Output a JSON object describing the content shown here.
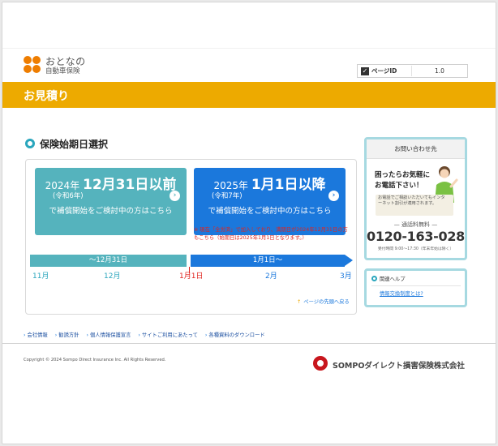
{
  "header": {
    "logo_line1": "おとなの",
    "logo_line2": "自動車保険",
    "page_id_label": "ページID",
    "page_id_value": "1.0"
  },
  "titlebar": {
    "title": "お見積り"
  },
  "section": {
    "title": "保険始期日選択"
  },
  "cards": [
    {
      "year_prefix": "2024年 ",
      "date": "12月31日",
      "suffix": "以前",
      "era": "(令和6年)",
      "cta": "で補償開始をご検討中の方はこちら"
    },
    {
      "year_prefix": "2025年 ",
      "date": "1月1日",
      "suffix": "以降",
      "era": "(令和7年)",
      "cta": "で補償開始をご検討中の方はこちら"
    }
  ],
  "note": "※ 現在「全労済」で加入しており、満期日が2024年12月31日の方もこちら（始期日は2025年1月1日となります。）",
  "timeline": {
    "left_label": "〜12月31日",
    "right_label": "1月1日〜",
    "months": [
      "11月",
      "12月",
      "1月1日",
      "2月",
      "3月"
    ]
  },
  "page_top_link": "ページの先頭へ戻る",
  "contact": {
    "title": "お問い合わせ先",
    "message": "困ったらお気軽にお電話下さい！",
    "bubble": "お電話でご相談いただいてもインターネット割引が適用されます。",
    "free_label": "— 通話料無料 —",
    "tel": "0120-163-028",
    "hours": "受付時間 9:00〜17:30（年末年始は除く）"
  },
  "help": {
    "title": "関連ヘルプ",
    "link": "情報交換制度とは?"
  },
  "footer": {
    "links": [
      "会社情報",
      "勧誘方針",
      "個人情報保護宣言",
      "サイトご利用にあたって",
      "各種資料のダウンロード"
    ],
    "copyright": "Copyright © 2024 Sompo Direct Insurance Inc. All Rights Reserved.",
    "company": "SOMPOダイレクト損害保険株式会社"
  },
  "colors": {
    "accent": "#edaa00",
    "teal": "#55b3bd",
    "blue": "#1b78dc",
    "red": "#e0241e"
  }
}
